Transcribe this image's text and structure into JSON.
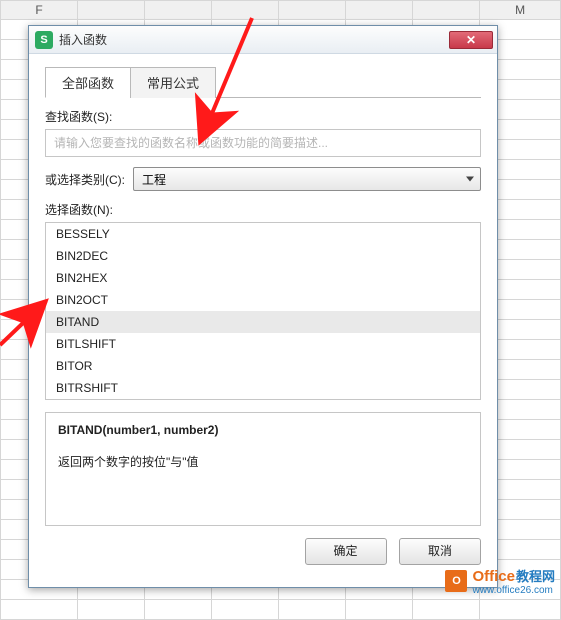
{
  "spreadsheet": {
    "col_headers": [
      "F",
      "",
      "",
      "",
      "",
      "",
      "",
      "M"
    ]
  },
  "dialog": {
    "title": "插入函数",
    "close_glyph": "✕",
    "tabs": {
      "all": "全部函数",
      "common": "常用公式"
    },
    "search_label": "查找函数(S):",
    "search_placeholder": "请输入您要查找的函数名称或函数功能的简要描述...",
    "category_label": "或选择类别(C):",
    "category_value": "工程",
    "funclist_label": "选择函数(N):",
    "functions": [
      "BESSELY",
      "BIN2DEC",
      "BIN2HEX",
      "BIN2OCT",
      "BITAND",
      "BITLSHIFT",
      "BITOR",
      "BITRSHIFT"
    ],
    "selected_index": 4,
    "signature": "BITAND(number1, number2)",
    "description": "返回两个数字的按位\"与\"值",
    "ok": "确定",
    "cancel": "取消"
  },
  "watermark": {
    "brand": "Office",
    "suffix": "教程网",
    "url": "www.office26.com"
  }
}
